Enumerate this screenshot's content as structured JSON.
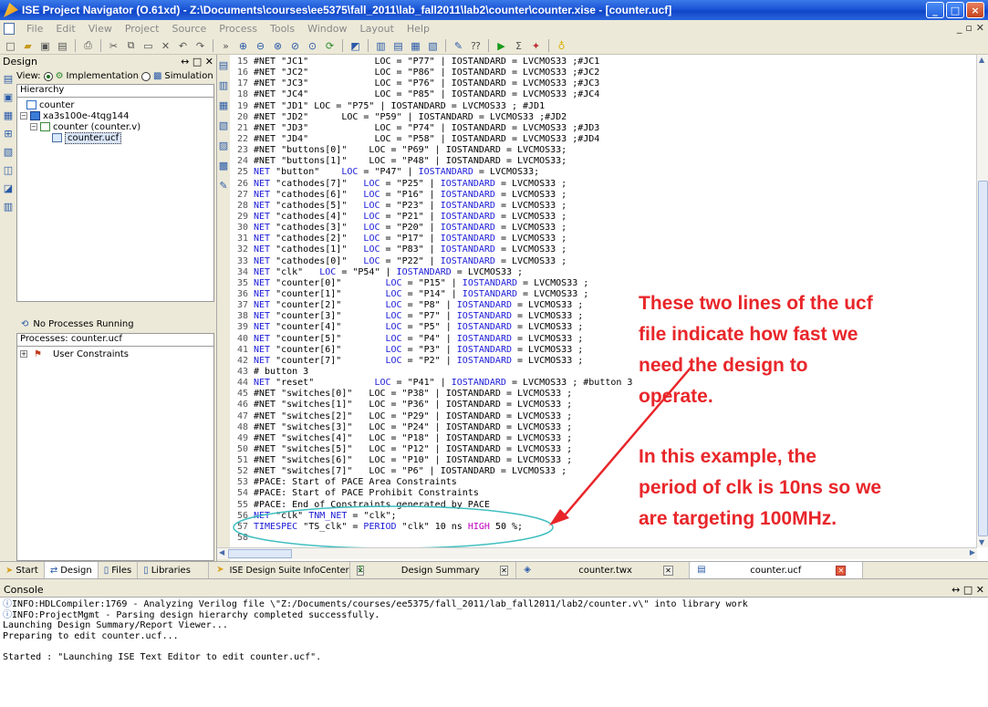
{
  "window": {
    "title": "ISE Project Navigator (O.61xd) - Z:\\Documents\\courses\\ee5375\\fall_2011\\lab_fall2011\\lab2\\counter\\counter.xise - [counter.ucf]",
    "min": "_",
    "max": "□",
    "close": "×"
  },
  "menu": [
    "File",
    "Edit",
    "View",
    "Project",
    "Source",
    "Process",
    "Tools",
    "Window",
    "Layout",
    "Help"
  ],
  "design_panel": {
    "title": "Design",
    "controls": "↔ □ ✕",
    "view_label": "View:",
    "implementation": "Implementation",
    "simulation": "Simulation",
    "hierarchy_header": "Hierarchy",
    "tree": [
      "counter",
      "xa3s100e-4tqg144",
      "counter (counter.v)",
      "counter.ucf"
    ],
    "process_status": "No Processes Running",
    "processes_header": "Processes: counter.ucf",
    "process_item": "User Constraints"
  },
  "editor_lines": [
    {
      "n": "15",
      "t": "#NET \"JC1\"            LOC = \"P77\" | IOSTANDARD = LVCMOS33 ;#JC1"
    },
    {
      "n": "16",
      "t": "#NET \"JC2\"            LOC = \"P86\" | IOSTANDARD = LVCMOS33 ;#JC2"
    },
    {
      "n": "17",
      "t": "#NET \"JC3\"            LOC = \"P76\" | IOSTANDARD = LVCMOS33 ;#JC3"
    },
    {
      "n": "18",
      "t": "#NET \"JC4\"            LOC = \"P85\" | IOSTANDARD = LVCMOS33 ;#JC4"
    },
    {
      "n": "19",
      "t": "#NET \"JD1\" LOC = \"P75\" | IOSTANDARD = LVCMOS33 ; #JD1"
    },
    {
      "n": "20",
      "t": "#NET \"JD2\"      LOC = \"P59\" | IOSTANDARD = LVCMOS33 ;#JD2"
    },
    {
      "n": "21",
      "t": "#NET \"JD3\"            LOC = \"P74\" | IOSTANDARD = LVCMOS33 ;#JD3"
    },
    {
      "n": "22",
      "t": "#NET \"JD4\"            LOC = \"P58\" | IOSTANDARD = LVCMOS33 ;#JD4"
    },
    {
      "n": "23",
      "t": "#NET \"buttons[0]\"    LOC = \"P69\" | IOSTANDARD = LVCMOS33;"
    },
    {
      "n": "24",
      "t": "#NET \"buttons[1]\"    LOC = \"P48\" | IOSTANDARD = LVCMOS33;"
    },
    {
      "n": "25",
      "t": "NET \"button\"    LOC = \"P47\" | IOSTANDARD = LVCMOS33;",
      "kw": true
    },
    {
      "n": "26",
      "t": "NET \"cathodes[7]\"   LOC = \"P25\" | IOSTANDARD = LVCMOS33 ;",
      "kw": true
    },
    {
      "n": "27",
      "t": "NET \"cathodes[6]\"   LOC = \"P16\" | IOSTANDARD = LVCMOS33 ;",
      "kw": true
    },
    {
      "n": "28",
      "t": "NET \"cathodes[5]\"   LOC = \"P23\" | IOSTANDARD = LVCMOS33 ;",
      "kw": true
    },
    {
      "n": "29",
      "t": "NET \"cathodes[4]\"   LOC = \"P21\" | IOSTANDARD = LVCMOS33 ;",
      "kw": true
    },
    {
      "n": "30",
      "t": "NET \"cathodes[3]\"   LOC = \"P20\" | IOSTANDARD = LVCMOS33 ;",
      "kw": true
    },
    {
      "n": "31",
      "t": "NET \"cathodes[2]\"   LOC = \"P17\" | IOSTANDARD = LVCMOS33 ;",
      "kw": true
    },
    {
      "n": "32",
      "t": "NET \"cathodes[1]\"   LOC = \"P83\" | IOSTANDARD = LVCMOS33 ;",
      "kw": true
    },
    {
      "n": "33",
      "t": "NET \"cathodes[0]\"   LOC = \"P22\" | IOSTANDARD = LVCMOS33 ;",
      "kw": true
    },
    {
      "n": "34",
      "t": "NET \"clk\"   LOC = \"P54\" | IOSTANDARD = LVCMOS33 ;",
      "kw": true
    },
    {
      "n": "35",
      "t": "NET \"counter[0]\"        LOC = \"P15\" | IOSTANDARD = LVCMOS33 ;",
      "kw": true
    },
    {
      "n": "36",
      "t": "NET \"counter[1]\"        LOC = \"P14\" | IOSTANDARD = LVCMOS33 ;",
      "kw": true
    },
    {
      "n": "37",
      "t": "NET \"counter[2]\"        LOC = \"P8\" | IOSTANDARD = LVCMOS33 ;",
      "kw": true
    },
    {
      "n": "38",
      "t": "NET \"counter[3]\"        LOC = \"P7\" | IOSTANDARD = LVCMOS33 ;",
      "kw": true
    },
    {
      "n": "39",
      "t": "NET \"counter[4]\"        LOC = \"P5\" | IOSTANDARD = LVCMOS33 ;",
      "kw": true
    },
    {
      "n": "40",
      "t": "NET \"counter[5]\"        LOC = \"P4\" | IOSTANDARD = LVCMOS33 ;",
      "kw": true
    },
    {
      "n": "41",
      "t": "NET \"counter[6]\"        LOC = \"P3\" | IOSTANDARD = LVCMOS33 ;",
      "kw": true
    },
    {
      "n": "42",
      "t": "NET \"counter[7]\"        LOC = \"P2\" | IOSTANDARD = LVCMOS33 ;",
      "kw": true
    },
    {
      "n": "43",
      "t": "# button 3"
    },
    {
      "n": "44",
      "t": "NET \"reset\"           LOC = \"P41\" | IOSTANDARD = LVCMOS33 ; #button 3",
      "kw": true
    },
    {
      "n": "45",
      "t": "#NET \"switches[0]\"   LOC = \"P38\" | IOSTANDARD = LVCMOS33 ;"
    },
    {
      "n": "46",
      "t": "#NET \"switches[1]\"   LOC = \"P36\" | IOSTANDARD = LVCMOS33 ;"
    },
    {
      "n": "47",
      "t": "#NET \"switches[2]\"   LOC = \"P29\" | IOSTANDARD = LVCMOS33 ;"
    },
    {
      "n": "48",
      "t": "#NET \"switches[3]\"   LOC = \"P24\" | IOSTANDARD = LVCMOS33 ;"
    },
    {
      "n": "49",
      "t": "#NET \"switches[4]\"   LOC = \"P18\" | IOSTANDARD = LVCMOS33 ;"
    },
    {
      "n": "50",
      "t": "#NET \"switches[5]\"   LOC = \"P12\" | IOSTANDARD = LVCMOS33 ;"
    },
    {
      "n": "51",
      "t": "#NET \"switches[6]\"   LOC = \"P10\" | IOSTANDARD = LVCMOS33 ;"
    },
    {
      "n": "52",
      "t": "#NET \"switches[7]\"   LOC = \"P6\" | IOSTANDARD = LVCMOS33 ;"
    },
    {
      "n": "53",
      "t": "#PACE: Start of PACE Area Constraints"
    },
    {
      "n": "54",
      "t": "#PACE: Start of PACE Prohibit Constraints"
    },
    {
      "n": "55",
      "t": "#PACE: End of Constraints generated by PACE"
    },
    {
      "n": "56",
      "t": "NET \"clk\" TNM_NET = \"clk\";",
      "kw": true
    },
    {
      "n": "57",
      "t": "TIMESPEC \"TS_clk\" = PERIOD \"clk\" 10 ns HIGH 50 %;",
      "kw": true
    },
    {
      "n": "58",
      "t": ""
    }
  ],
  "annotation": {
    "line1": "These two lines of the ucf",
    "line2": "file indicate how fast we",
    "line3": "need the design to",
    "line4": "operate.",
    "line5": "In this example, the",
    "line6": "period of clk is 10ns so we",
    "line7": "are targeting 100MHz.",
    "color": "#e8262a"
  },
  "left_tabs": [
    "Start",
    "Design",
    "Files",
    "Libraries"
  ],
  "editor_tabs": [
    "ISE Design Suite InfoCenter",
    "Design Summary",
    "counter.twx",
    "counter.ucf"
  ],
  "console": {
    "title": "Console",
    "controls": "↔ □ ✕",
    "lines": [
      "INFO:HDLCompiler:1769 - Analyzing Verilog file \\\"Z:/Documents/courses/ee5375/fall_2011/lab_fall2011/lab2/counter.v\\\" into library work",
      "INFO:ProjectMgmt - Parsing design hierarchy completed successfully.",
      "Launching Design Summary/Report Viewer...",
      "Preparing to edit counter.ucf...",
      "",
      "Started : \"Launching ISE Text Editor to edit counter.ucf\"."
    ]
  }
}
